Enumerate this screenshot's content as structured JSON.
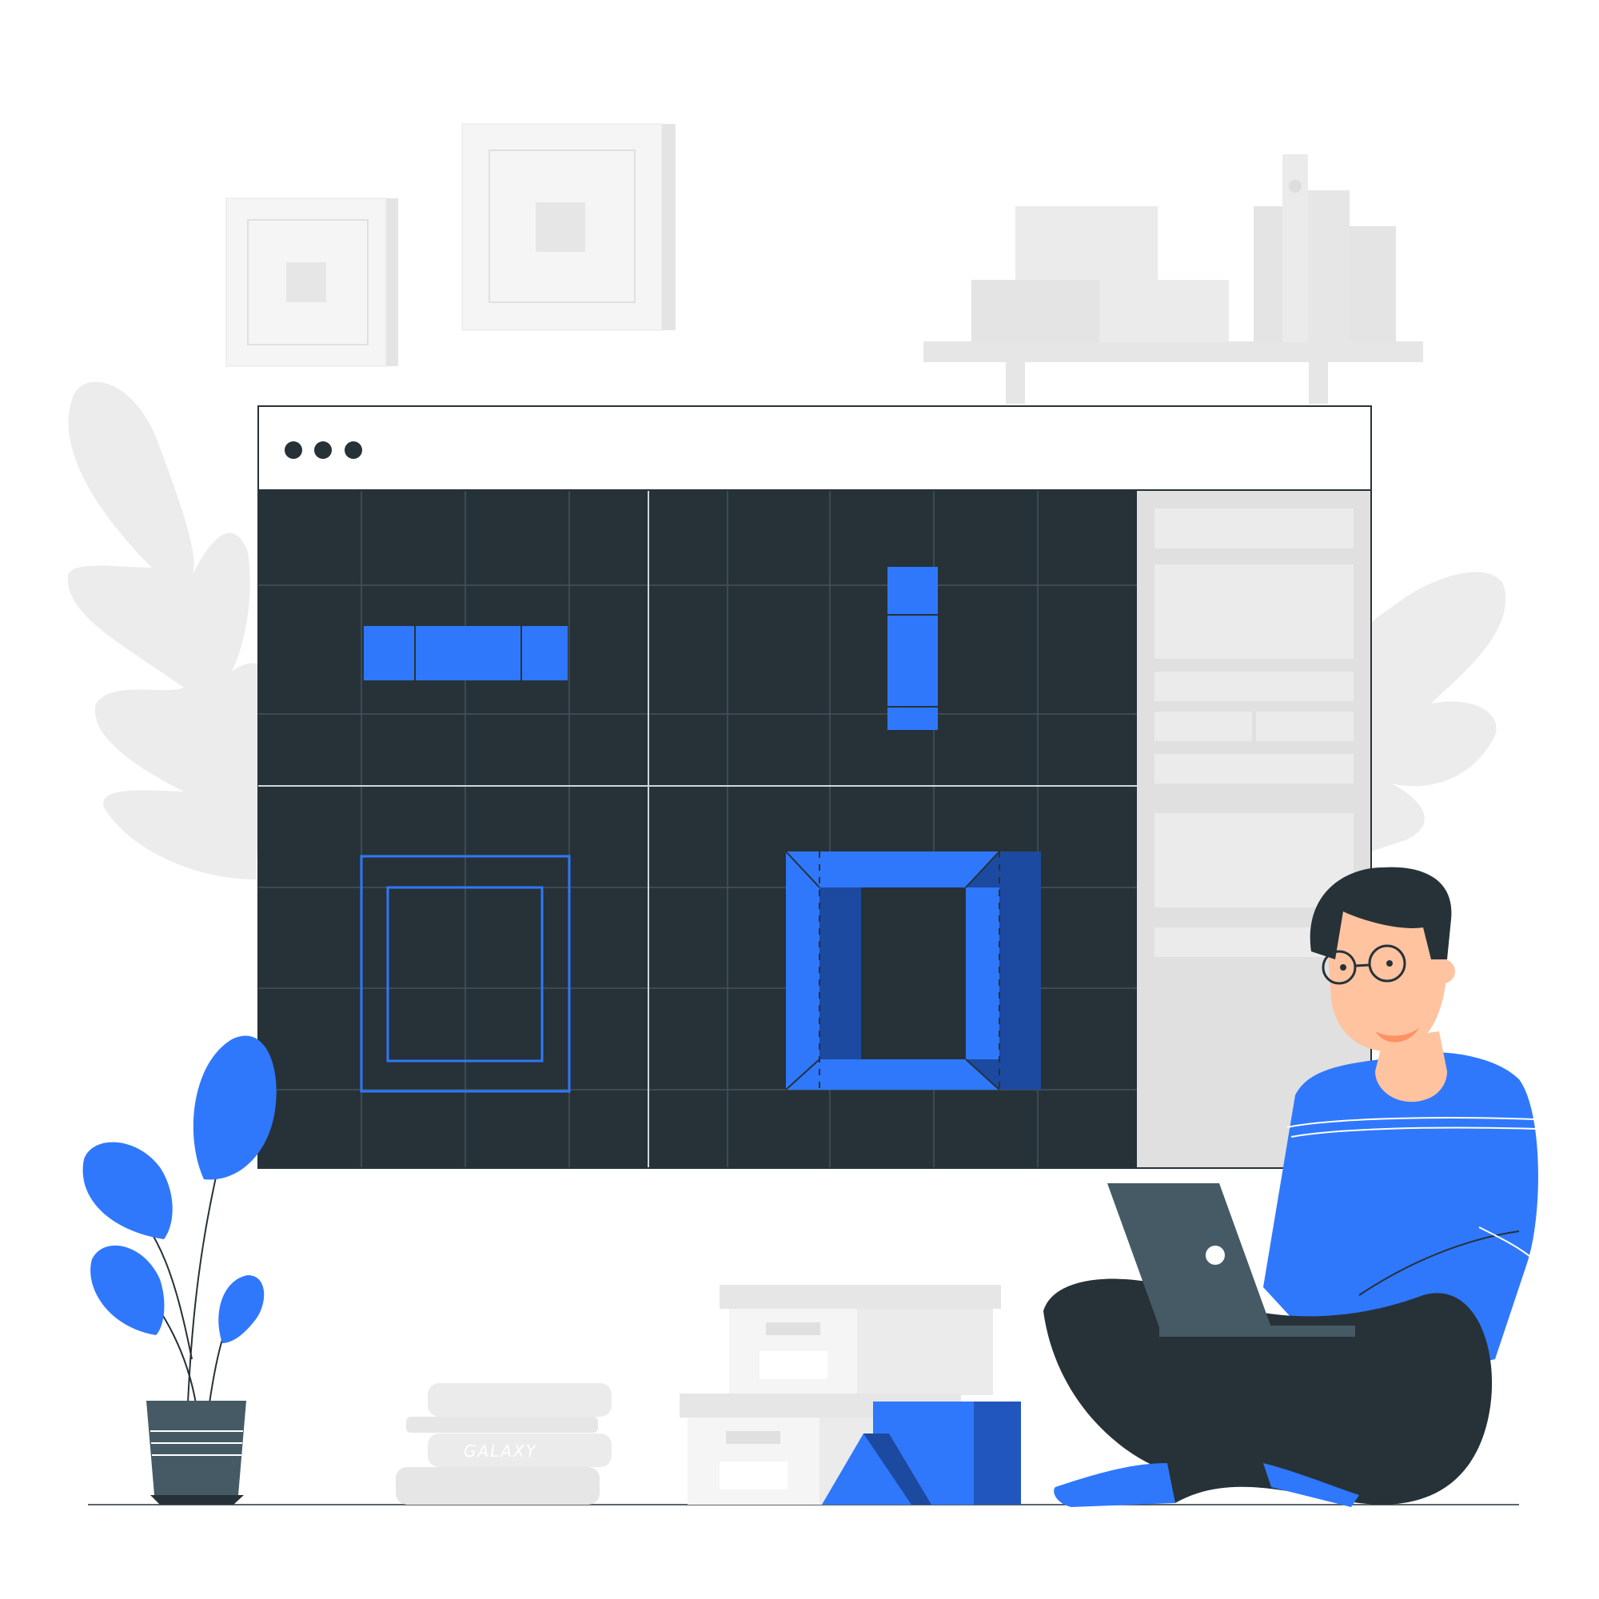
{
  "illustration": {
    "book_spine_label": "GALAXY"
  },
  "colors": {
    "accent_blue": "#2f78fc",
    "accent_blue_dark": "#1c4aa0",
    "editor_dark": "#263238",
    "grid_line": "#45535a",
    "grid_axis": "#cfd8dc",
    "light_gray": "#ebebeb",
    "mid_gray": "#e0e0e0",
    "laptop_gray": "#455a64",
    "skin": "#ffc3a0",
    "hair": "#263238"
  },
  "icons": {
    "window_controls": "three-dots-icon",
    "laptop_logo": "apple-dot-icon"
  }
}
